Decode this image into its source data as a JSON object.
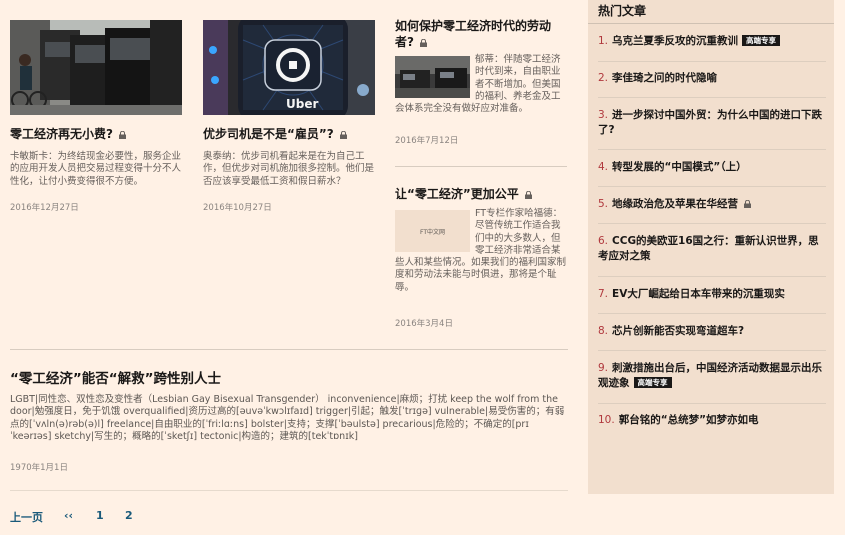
{
  "articles": [
    {
      "title": "零工经济再无小费?",
      "summary": "卡敏斯卡：为终结现金必要性，服务企业的应用开发人员把交易过程变得十分不人性化，让付小费变得很不方便。",
      "date": "2016年12月27日",
      "locked": true
    },
    {
      "title": "优步司机是不是“雇员”?",
      "summary": "奥泰纳：优步司机看起来是在为自己工作，但优步对司机施加很多控制。他们是否应该享受最低工资和假日薪水？",
      "date": "2016年10月27日",
      "locked": true,
      "image_logo_text": "Uber"
    },
    {
      "title": "如何保护零工经济时代的劳动者?",
      "summary": "郁蒂：伴随零工经济时代到来，自由职业者不断增加。但美国的福利、养老金及工会体系完全没有做好应对准备。",
      "date": "2016年7月12日",
      "locked": true
    },
    {
      "title": "让“零工经济”更加公平",
      "summary": "FT专栏作家哈福德：尽管传统工作适合我们中的大多数人，但零工经济非常适合某些人和某些情况。如果我们的福利国家制度和劳动法未能与时俱进，那将是个耻辱。",
      "date": "2016年3月4日",
      "locked": true,
      "image_caption": "FT中文网"
    },
    {
      "title": "“零工经济”能否“解救”跨性别人士",
      "summary": "LGBT|同性恋、双性恋及变性者（Lesbian Gay Bisexual Transgender） inconvenience|麻烦；打扰 keep the wolf from the door|勉强度日，免于饥饿 overqualified|资历过高的[əuvəˈkwɔlɪfaɪd] trigger|引起；触发[ˈtrɪɡə] vulnerable|易受伤害的；有弱点的[ˈvʌln(ə)rəb(ə)l] freelance|自由职业的[ˈfriːlɑːns] bolster|支持；支撑[ˈbəulstə] precarious|危险的；不确定的[prɪˈkeərɪəs] sketchy|写生的；概略的[ˈsketʃɪ] tectonic|构造的；建筑的[tekˈtɒnɪk]",
      "date": "1970年1月1日",
      "locked": false
    }
  ],
  "pagination": {
    "prev": "上一页",
    "first": "‹‹",
    "pages": [
      "1",
      "2"
    ]
  },
  "sidebar": {
    "heading": "热门文章",
    "items": [
      {
        "num": "1.",
        "title": "乌克兰夏季反攻的沉重教训",
        "tag": "高端专享"
      },
      {
        "num": "2.",
        "title": "李佳琦之问的时代隐喻",
        "tag": ""
      },
      {
        "num": "3.",
        "title": "进一步探讨中国外贸：为什么中国的进口下跌了?",
        "tag": ""
      },
      {
        "num": "4.",
        "title": "转型发展的“中国模式”（上）",
        "tag": ""
      },
      {
        "num": "5.",
        "title": "地缘政治危及苹果在华经营",
        "tag": "",
        "locked": true
      },
      {
        "num": "6.",
        "title": "CCG的美欧亚16国之行：重新认识世界，思考应对之策",
        "tag": ""
      },
      {
        "num": "7.",
        "title": "EV大厂崛起给日本车带来的沉重现实",
        "tag": ""
      },
      {
        "num": "8.",
        "title": "芯片创新能否实现弯道超车?",
        "tag": ""
      },
      {
        "num": "9.",
        "title": "刺激措施出台后，中国经济活动数据显示出乐观迹象",
        "tag": "高端专享"
      },
      {
        "num": "10.",
        "title": "郭台铭的“总统梦”如梦亦如电",
        "tag": ""
      }
    ]
  },
  "colors": {
    "background": "#fff1e5",
    "sidebar": "#f2dfce",
    "accent_number": "#b0383d",
    "pager_link": "#1a5a7a"
  }
}
